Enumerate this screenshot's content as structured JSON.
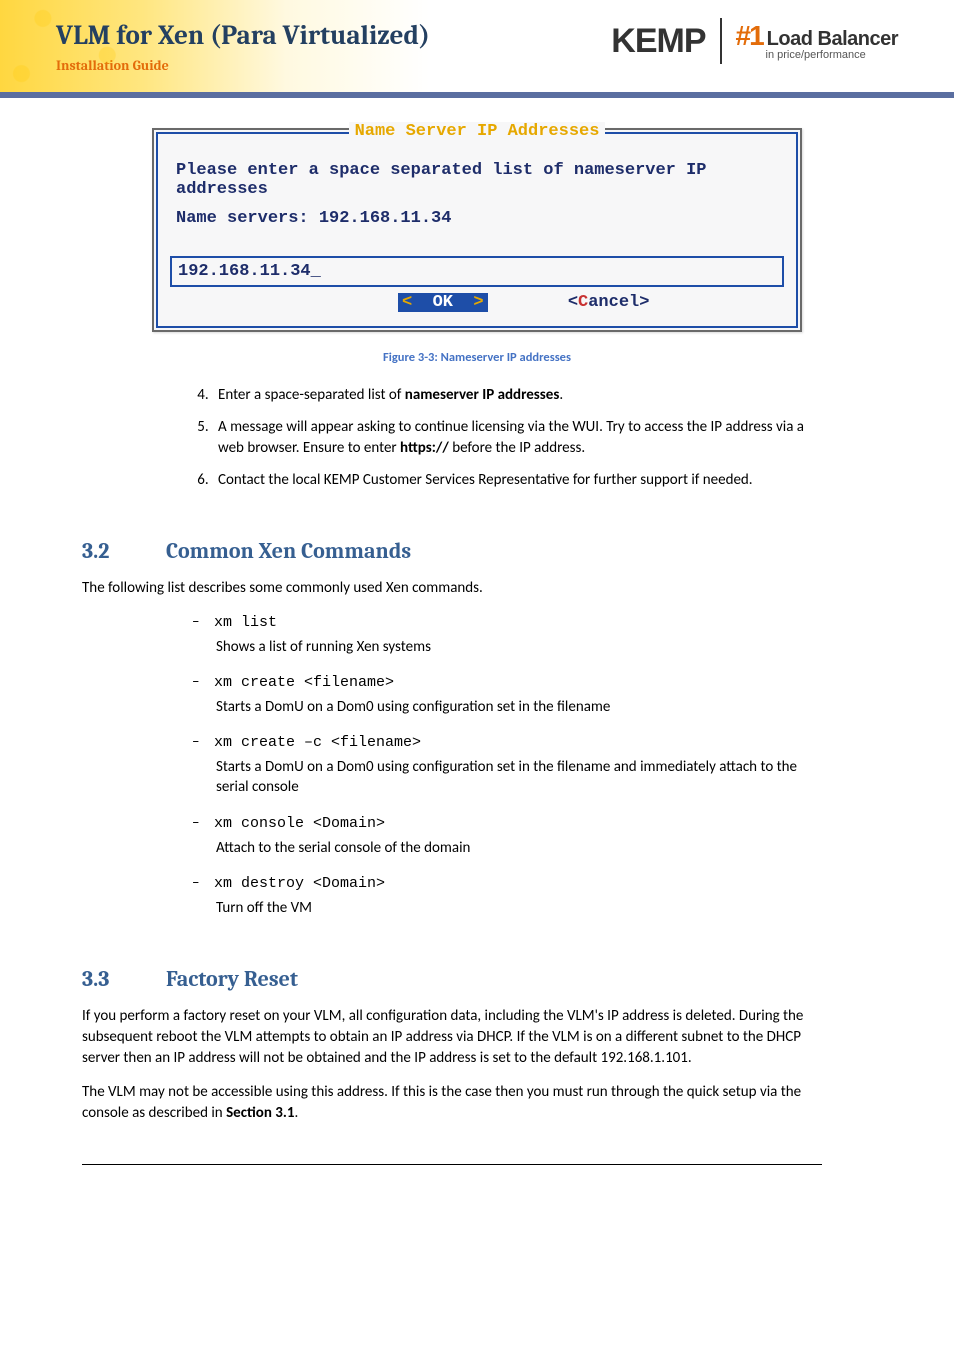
{
  "header": {
    "title": "VLM for Xen (Para Virtualized)",
    "subtitle": "Installation Guide",
    "logo_kemp": "KEMP",
    "logo_hash": "#1",
    "logo_lb": "Load Balancer",
    "logo_lb_sub": "in price/performance"
  },
  "terminal": {
    "title": "Name Server IP Addresses",
    "prompt": "Please enter a space separated list of nameserver IP addresses",
    "label": "Name servers: 192.168.11.34",
    "input_value": "192.168.11.34_",
    "ok": "OK",
    "cancel": "Cancel"
  },
  "figure_caption": "Figure 3-3: Nameserver IP addresses",
  "steps": {
    "start": 4,
    "items": [
      {
        "pre": "Enter a space-separated list of ",
        "bold": "nameserver IP addresses",
        "post": "."
      },
      {
        "pre": "A message will appear asking to continue licensing via the WUI. Try to access the IP address via a web browser. Ensure to enter ",
        "bold": "https://",
        "post": " before the IP address."
      },
      {
        "pre": "Contact the local KEMP Customer Services Representative for further support if needed.",
        "bold": "",
        "post": ""
      }
    ]
  },
  "section32": {
    "num": "3.2",
    "title": "Common Xen Commands",
    "intro": "The following list describes some commonly used Xen commands.",
    "commands": [
      {
        "code": "xm list",
        "desc": "Shows a list of running Xen systems"
      },
      {
        "code": "xm create <filename>",
        "desc": "Starts a DomU on a Dom0 using configuration set in the filename"
      },
      {
        "code": "xm create –c <filename>",
        "desc": "Starts a DomU on a Dom0 using configuration set in the filename and immediately attach to the serial console"
      },
      {
        "code": "xm console <Domain>",
        "desc": "Attach to the serial console of the domain"
      },
      {
        "code": "xm destroy <Domain>",
        "desc": "Turn off the VM"
      }
    ]
  },
  "section33": {
    "num": "3.3",
    "title": "Factory Reset",
    "p1": "If you perform a factory reset on your VLM, all configuration data, including the VLM's IP address is deleted. During the subsequent reboot the VLM attempts to obtain an IP address via DHCP. If the VLM is on a different subnet to the DHCP server then an IP address will not be obtained and the IP address is set to the default 192.168.1.101.",
    "p2_pre": "The VLM may not be accessible using this address. If this is the case then you must run through the quick setup via the console as described in ",
    "p2_bold": "Section 3.1",
    "p2_post": "."
  }
}
